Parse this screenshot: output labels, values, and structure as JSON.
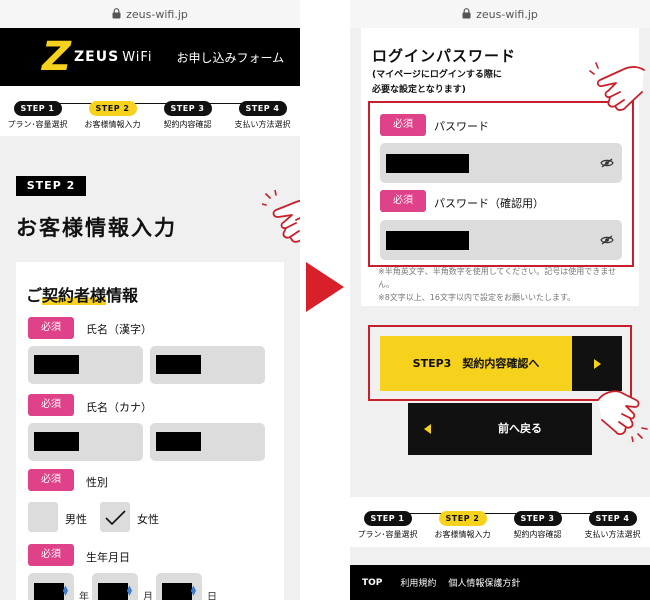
{
  "url": "zeus-wifi.jp",
  "header": {
    "logo_mark": "Z",
    "logo_name": "ZEUS",
    "logo_suffix": "WiFi",
    "title": "お申し込みフォーム"
  },
  "steps": [
    {
      "pill": "STEP 1",
      "label": "プラン･容量選択",
      "active": false
    },
    {
      "pill": "STEP 2",
      "label": "お客様情報入力",
      "active": true
    },
    {
      "pill": "STEP 3",
      "label": "契約内容確認",
      "active": false
    },
    {
      "pill": "STEP 4",
      "label": "支払い方法選択",
      "active": false
    }
  ],
  "left": {
    "step_badge": "STEP 2",
    "page_title": "お客様情報入力",
    "section_title_plain": "ご",
    "section_title_highlight": "契約者様",
    "section_title_rest": "情報",
    "required": "必須",
    "fields": {
      "name_kanji": "氏名（漢字）",
      "name_kana": "氏名（カナ）",
      "gender": "性別",
      "birthdate": "生年月日"
    },
    "gender_male": "男性",
    "gender_female": "女性",
    "year_unit": "年",
    "month_unit": "月",
    "day_unit": "日"
  },
  "right": {
    "title": "ログインパスワード",
    "subtitle_line1": "(マイページにログインする際に",
    "subtitle_line2": "必要な設定となります)",
    "required": "必須",
    "password_label": "パスワード",
    "password_confirm_label": "パスワード（確認用）",
    "note_line1": "※半角英文字、半角数字を使用してください。記号は使用できません。",
    "note_line2": "※8文字以上、16文字以内で設定をお願いいたします。",
    "next_button": "STEP3　契約内容確認へ",
    "back_button": "前へ戻る"
  },
  "footer": {
    "top": "TOP",
    "terms": "利用規約",
    "privacy": "個人情報保護方針"
  },
  "colors": {
    "brand_yellow": "#f6d21c",
    "required_pink": "#e0428a",
    "highlight_red": "#c8202b",
    "arrow_red": "#d8202a"
  }
}
